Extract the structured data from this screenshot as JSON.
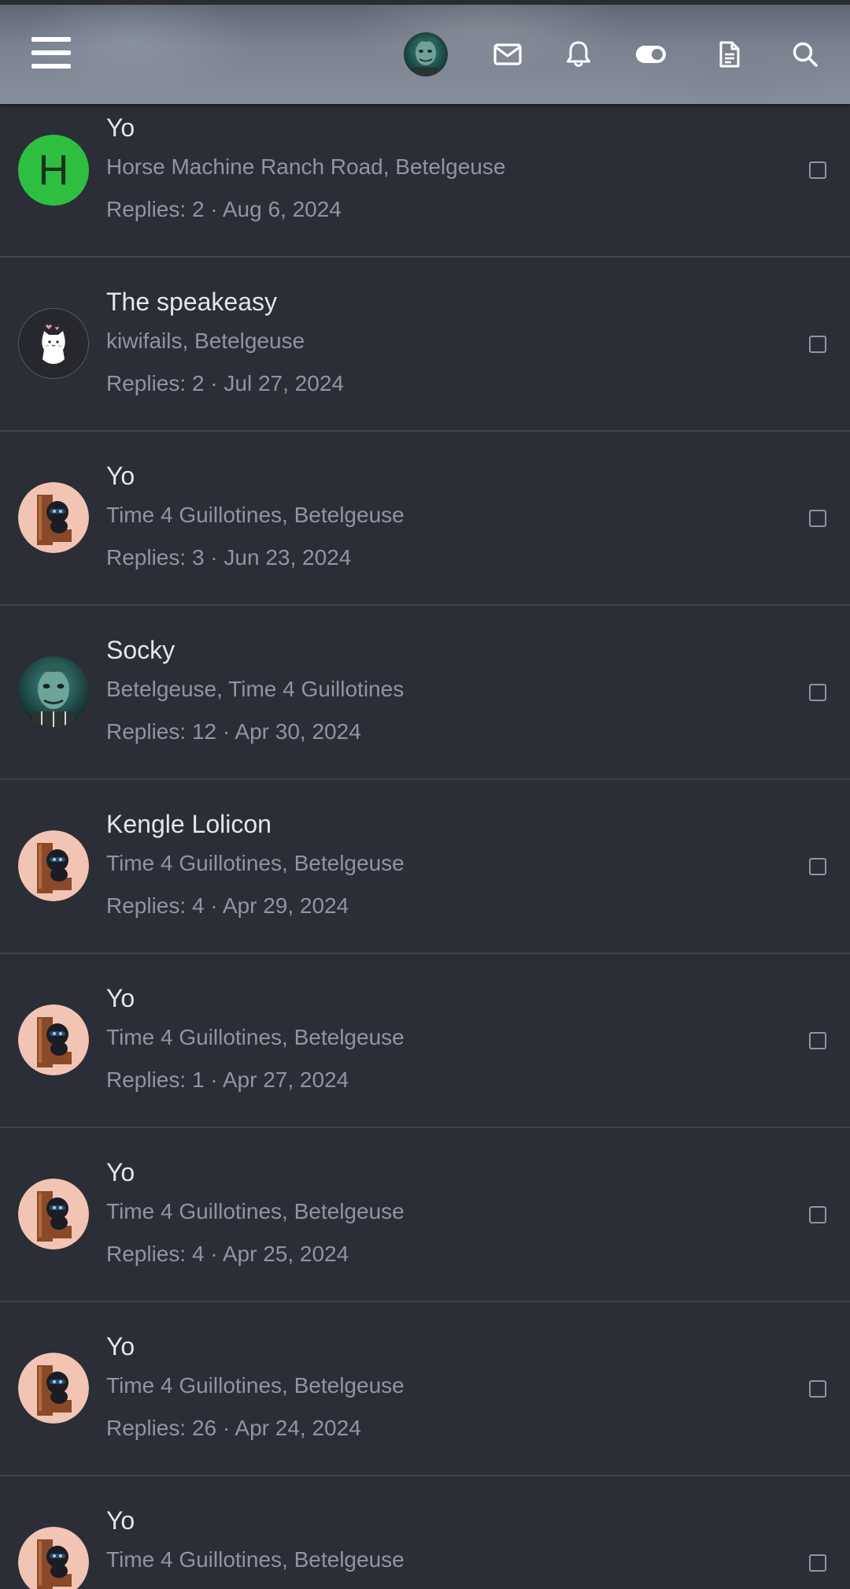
{
  "header": {
    "menu_icon": "hamburger-menu-icon",
    "avatar_icon": "user-avatar-icon",
    "mail_icon": "envelope-icon",
    "bell_icon": "bell-icon",
    "toggle_icon": "toggle-icon",
    "doc_icon": "document-icon",
    "search_icon": "search-icon"
  },
  "colors": {
    "background": "#2b2e36",
    "title_text": "#e4e6ea",
    "muted_text": "#8e95a4",
    "divider": "#40434c",
    "green_avatar": "#2fbf40"
  },
  "conversations": [
    {
      "title": "Yo",
      "participants": "Horse Machine Ranch Road, Betelgeuse",
      "meta": "Replies: 2 · Aug 6, 2024",
      "avatar": "letter-H",
      "avatar_letter": "H"
    },
    {
      "title": "The speakeasy",
      "participants": "kiwifails, Betelgeuse",
      "meta": "Replies: 2 · Jul 27, 2024",
      "avatar": "cat-avatar"
    },
    {
      "title": "Yo",
      "participants": "Time 4 Guillotines, Betelgeuse",
      "meta": "Replies: 3 · Jun 23, 2024",
      "avatar": "peeking-ninja-avatar"
    },
    {
      "title": "Socky",
      "participants": "Betelgeuse, Time 4 Guillotines",
      "meta": "Replies: 12 · Apr 30, 2024",
      "avatar": "betelgeuse-avatar"
    },
    {
      "title": "Kengle Lolicon",
      "participants": "Time 4 Guillotines, Betelgeuse",
      "meta": "Replies: 4 · Apr 29, 2024",
      "avatar": "peeking-ninja-avatar"
    },
    {
      "title": "Yo",
      "participants": "Time 4 Guillotines, Betelgeuse",
      "meta": "Replies: 1 · Apr 27, 2024",
      "avatar": "peeking-ninja-avatar"
    },
    {
      "title": "Yo",
      "participants": "Time 4 Guillotines, Betelgeuse",
      "meta": "Replies: 4 · Apr 25, 2024",
      "avatar": "peeking-ninja-avatar"
    },
    {
      "title": "Yo",
      "participants": "Time 4 Guillotines, Betelgeuse",
      "meta": "Replies: 26 · Apr 24, 2024",
      "avatar": "peeking-ninja-avatar"
    },
    {
      "title": "Yo",
      "participants": "Time 4 Guillotines, Betelgeuse",
      "meta": "",
      "avatar": "peeking-ninja-avatar"
    }
  ]
}
